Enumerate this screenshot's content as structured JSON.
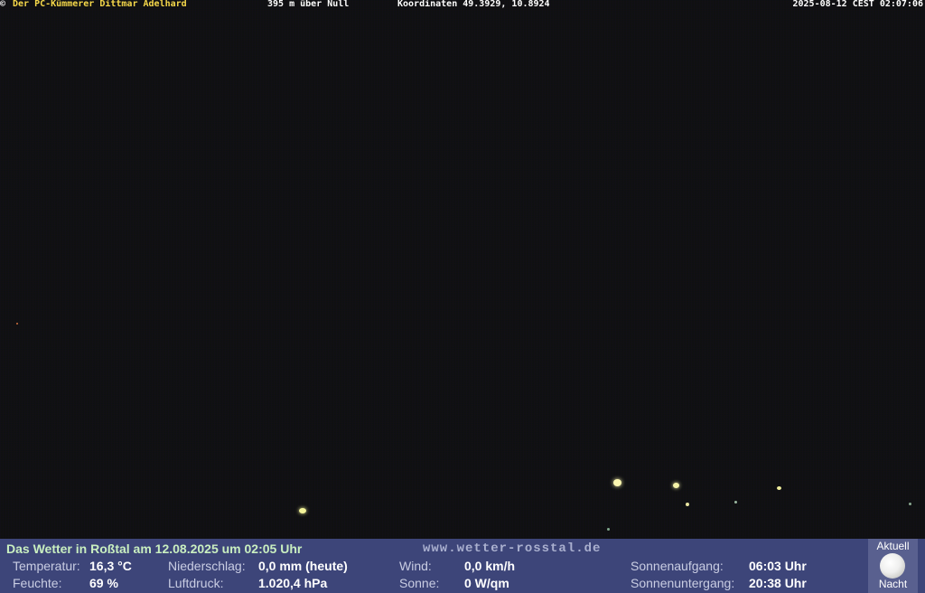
{
  "overlay": {
    "copyright_symbol": "©",
    "author": "Der PC-Kümmerer Dittmar Adelhard",
    "altitude": "395 m über Null",
    "coordinates": "Koordinaten 49.3929, 10.8924",
    "timestamp": "2025-08-12 CEST 02:07:06"
  },
  "colors": {
    "overlay_author": "#f6d84a",
    "panel_background": "#3d4579",
    "title_color": "#c9efc0"
  },
  "panel": {
    "title": "Das Wetter in Roßtal am 12.08.2025 um 02:05 Uhr",
    "url": "www.wetter-rosstal.de",
    "temperature": {
      "label": "Temperatur:",
      "value": "16,3 °C"
    },
    "humidity": {
      "label": "Feuchte:",
      "value": "69 %"
    },
    "precipitation": {
      "label": "Niederschlag:",
      "value": "0,0 mm (heute)"
    },
    "pressure": {
      "label": "Luftdruck:",
      "value": "1.020,4 hPa"
    },
    "wind": {
      "label": "Wind:",
      "value": "0,0 km/h"
    },
    "sun": {
      "label": "Sonne:",
      "value": "0 W/qm"
    },
    "sunrise": {
      "label": "Sonnenaufgang:",
      "value": "06:03 Uhr"
    },
    "sunset": {
      "label": "Sonnenuntergang:",
      "value": "20:38 Uhr"
    }
  },
  "moon": {
    "label_top": "Aktuell",
    "label_bottom": "Nacht",
    "icon": "moon-icon"
  }
}
